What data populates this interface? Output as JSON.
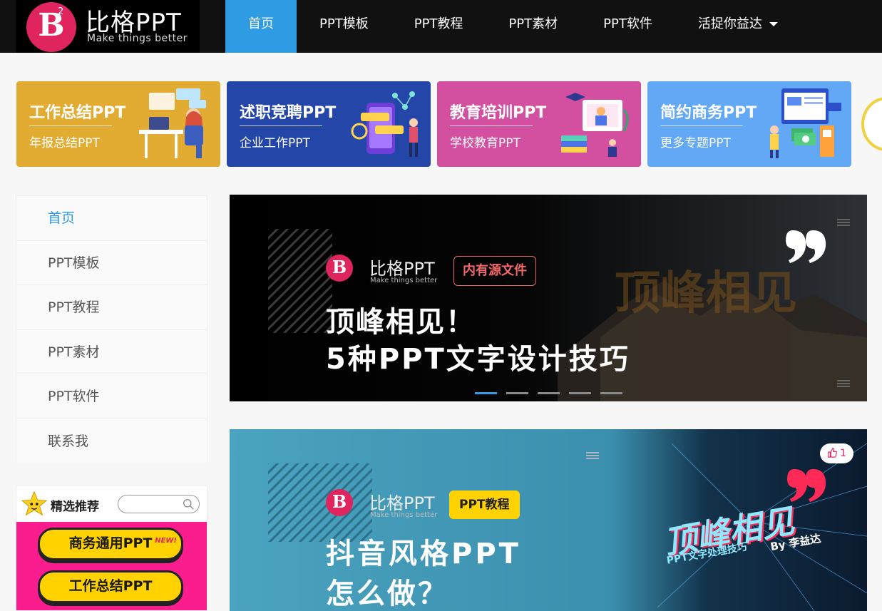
{
  "brand": {
    "logo_letter": "B",
    "logo_superscript": "2",
    "name": "比格PPT",
    "tagline": "Make things better"
  },
  "nav": {
    "items": [
      {
        "label": "首页",
        "active": true
      },
      {
        "label": "PPT模板"
      },
      {
        "label": "PPT教程"
      },
      {
        "label": "PPT素材"
      },
      {
        "label": "PPT软件"
      },
      {
        "label": "活捉你益达",
        "dropdown": true
      }
    ]
  },
  "cards": [
    {
      "title": "工作总结PPT",
      "subtitle": "年报总结PPT",
      "color": "#e2ac32"
    },
    {
      "title": "述职竞聘PPT",
      "subtitle": "企业工作PPT",
      "color": "#2446a8"
    },
    {
      "title": "教育培训PPT",
      "subtitle": "学校教育PPT",
      "color": "#d34fa0"
    },
    {
      "title": "简约商务PPT",
      "subtitle": "更多专题PPT",
      "color": "#62a8f4"
    }
  ],
  "sidebar": {
    "items": [
      {
        "label": "首页",
        "active": true
      },
      {
        "label": "PPT模板"
      },
      {
        "label": "PPT教程"
      },
      {
        "label": "PPT素材"
      },
      {
        "label": "PPT软件"
      },
      {
        "label": "联系我"
      }
    ]
  },
  "recommend": {
    "title": "精选推荐",
    "buttons": [
      {
        "label": "商务通用PPT",
        "badge": "NEW!"
      },
      {
        "label": "工作总结PPT"
      }
    ]
  },
  "slider": {
    "brand_name": "比格PPT",
    "brand_tagline": "Make things better",
    "tag": "内有源文件",
    "headline_1": "顶峰相见！",
    "headline_2": "5种PPT文字设计技巧",
    "dots_count": 5,
    "active_dot": 0
  },
  "post": {
    "brand_name": "比格PPT",
    "brand_tagline": "Make things better",
    "tag": "PPT教程",
    "headline_1": "抖音风格PPT",
    "headline_2": "怎么做？",
    "art_title": "顶峰相见",
    "art_subtitle": "PPT文字处理技巧",
    "art_author": "By 李益达",
    "likes": "1"
  },
  "colors": {
    "accent": "#2d9ce3",
    "brand_pink": "#e0245e",
    "header_bg": "#111111"
  }
}
